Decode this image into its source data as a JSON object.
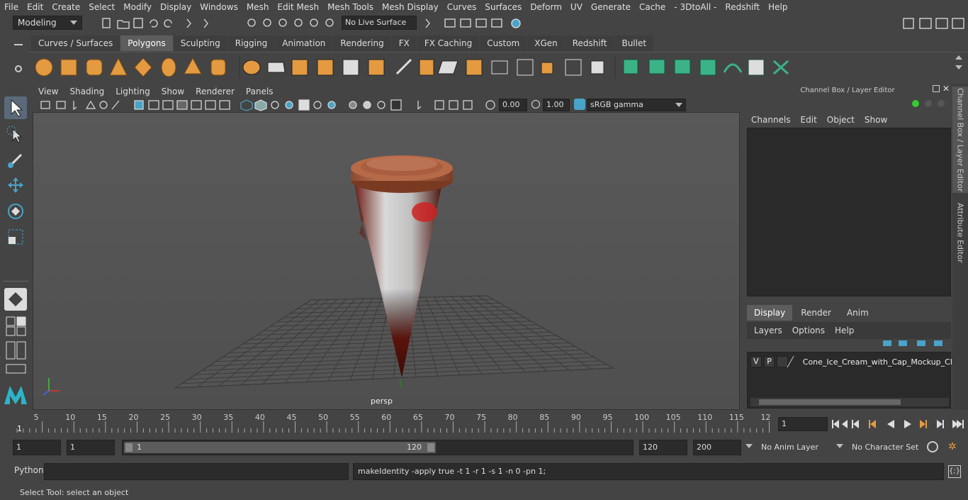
{
  "menubar": {
    "items": [
      "File",
      "Edit",
      "Create",
      "Select",
      "Modify",
      "Display",
      "Windows",
      "Mesh",
      "Edit Mesh",
      "Mesh Tools",
      "Mesh Display",
      "Curves",
      "Surfaces",
      "Deform",
      "UV",
      "Generate",
      "Cache",
      "- 3DtoAll -",
      "Redshift",
      "Help"
    ]
  },
  "statusline": {
    "workspace": "Modeling",
    "live_surface": "No Live Surface"
  },
  "shelf": {
    "tabs": [
      "Curves / Surfaces",
      "Polygons",
      "Sculpting",
      "Rigging",
      "Animation",
      "Rendering",
      "FX",
      "FX Caching",
      "Custom",
      "XGen",
      "Redshift",
      "Bullet"
    ],
    "active_tab": "Polygons"
  },
  "viewport": {
    "menu": [
      "View",
      "Shading",
      "Lighting",
      "Show",
      "Renderer",
      "Panels"
    ],
    "exposure": "0.00",
    "gamma": "1.00",
    "color_space": "sRGB gamma",
    "camera_label": "persp"
  },
  "right_panel": {
    "title": "Channel Box / Layer Editor",
    "channel_tabs": [
      "Channels",
      "Edit",
      "Object",
      "Show"
    ],
    "layer_tabs": [
      "Display",
      "Render",
      "Anim"
    ],
    "active_layer_tab": "Display",
    "layer_menu": [
      "Layers",
      "Options",
      "Help"
    ],
    "layer": {
      "v": "V",
      "p": "P",
      "name": "Cone_Ice_Cream_with_Cap_Mockup_Ch"
    },
    "vertical_tabs": [
      "Channel Box / Layer Editor",
      "Attribute Editor"
    ]
  },
  "timeline": {
    "ticks": [
      "5",
      "10",
      "15",
      "20",
      "25",
      "30",
      "35",
      "40",
      "45",
      "50",
      "55",
      "60",
      "65",
      "70",
      "75",
      "80",
      "85",
      "90",
      "95",
      "100",
      "105",
      "110",
      "115",
      "12"
    ],
    "start_label": "1",
    "current_frame": "1"
  },
  "range": {
    "start": "1",
    "playback_start": "1",
    "slider_start": "1",
    "slider_end": "120",
    "playback_end": "120",
    "end": "200",
    "anim_layer": "No Anim Layer",
    "character_set": "No Character Set"
  },
  "cmdline": {
    "language": "Python",
    "result": "makeIdentity -apply true -t 1 -r 1 -s 1 -n 0 -pn 1;"
  },
  "helpline": {
    "text": "Select Tool: select an object"
  }
}
